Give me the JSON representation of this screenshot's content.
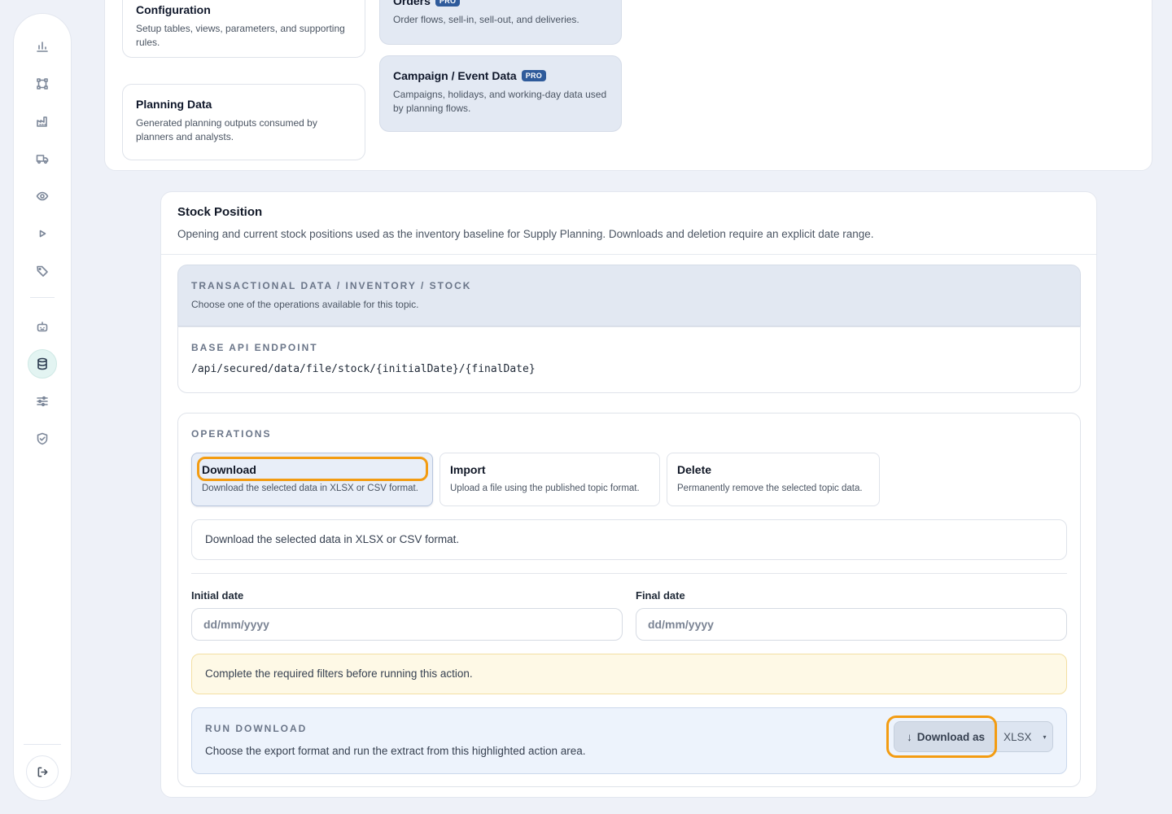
{
  "sidebar": {
    "items": [
      {
        "icon": "bar-chart-icon",
        "top": 0
      },
      {
        "icon": "workflow-icon"
      },
      {
        "icon": "factory-icon"
      },
      {
        "icon": "truck-icon"
      },
      {
        "icon": "eye-icon"
      },
      {
        "icon": "play-icon"
      },
      {
        "icon": "tag-icon"
      },
      {
        "icon": "bot-icon"
      },
      {
        "icon": "database-icon",
        "active": true
      },
      {
        "icon": "sliders-icon"
      },
      {
        "icon": "shield-check-icon"
      }
    ],
    "logout_icon": "logout-icon"
  },
  "catalog": {
    "configuration": {
      "title": "Configuration",
      "desc": "Setup tables, views, parameters, and supporting rules."
    },
    "planning_data": {
      "title": "Planning Data",
      "desc": "Generated planning outputs consumed by planners and analysts."
    },
    "orders": {
      "title": "Orders",
      "badge": "PRO",
      "desc": "Order flows, sell-in, sell-out, and deliveries."
    },
    "campaign": {
      "title": "Campaign / Event Data",
      "badge": "PRO",
      "desc": "Campaigns, holidays, and working-day data used by planning flows."
    }
  },
  "stock": {
    "title": "Stock Position",
    "subtitle": "Opening and current stock positions used as the inventory baseline for Supply Planning. Downloads and deletion require an explicit date range.",
    "topic": {
      "breadcrumb": "TRANSACTIONAL DATA / INVENTORY / STOCK",
      "desc": "Choose one of the operations available for this topic."
    },
    "endpoint": {
      "label": "BASE API ENDPOINT",
      "value": "/api/secured/data/file/stock/{initialDate}/{finalDate}"
    },
    "operations": {
      "label": "OPERATIONS",
      "download": {
        "title": "Download",
        "desc": "Download the selected data in XLSX or CSV format."
      },
      "import": {
        "title": "Import",
        "desc": "Upload a file using the published topic format."
      },
      "delete": {
        "title": "Delete",
        "desc": "Permanently remove the selected topic data."
      },
      "selected_desc": "Download the selected data in XLSX or CSV format."
    },
    "filters": {
      "initial_label": "Initial date",
      "initial_placeholder": "dd/mm/yyyy",
      "final_label": "Final date",
      "final_placeholder": "dd/mm/yyyy"
    },
    "warning": "Complete the required filters before running this action.",
    "run": {
      "label": "RUN DOWNLOAD",
      "desc": "Choose the export format and run the extract from this highlighted action area.",
      "button_label": "Download as",
      "button_arrow": "↓",
      "format": "XLSX",
      "caret": "▾"
    }
  },
  "colors": {
    "accent_highlight": "#f39c12",
    "pro_badge": "#2f5b9b",
    "active_nav": "#e3f4f2"
  }
}
